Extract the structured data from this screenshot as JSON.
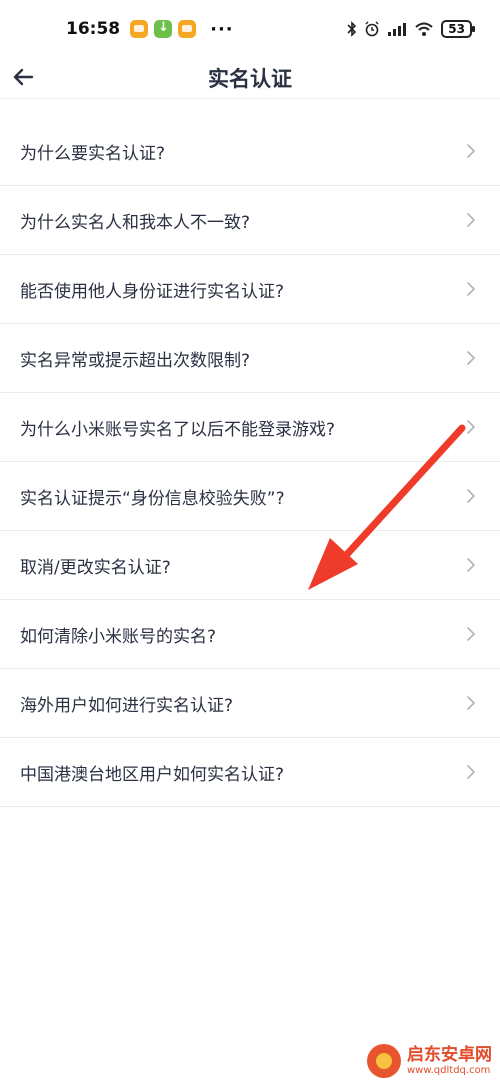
{
  "status_bar": {
    "time": "16:58",
    "battery": "53",
    "icons": [
      "notification-orange-icon",
      "download-green-icon",
      "notification-orange-icon",
      "more-dots-icon",
      "bluetooth-icon",
      "alarm-icon",
      "signal-icon",
      "wifi-icon",
      "battery-icon"
    ],
    "more": "···"
  },
  "header": {
    "title": "实名认证",
    "back_icon": "arrow-left-icon"
  },
  "faq_items": [
    {
      "label": "为什么要实名认证?"
    },
    {
      "label": "为什么实名人和我本人不一致?"
    },
    {
      "label": "能否使用他人身份证进行实名认证?"
    },
    {
      "label": "实名异常或提示超出次数限制?"
    },
    {
      "label": "为什么小米账号实名了以后不能登录游戏?"
    },
    {
      "label": "实名认证提示“身份信息校验失败”?"
    },
    {
      "label": "取消/更改实名认证?"
    },
    {
      "label": "如何清除小米账号的实名?"
    },
    {
      "label": "海外用户如何进行实名认证?"
    },
    {
      "label": "中国港澳台地区用户如何实名认证?"
    }
  ],
  "annotation": {
    "color": "#ee3b2a",
    "icon": "red-arrow-annotation"
  },
  "watermark": {
    "name": "启东安卓网",
    "url": "www.qdltdq.com"
  },
  "colors": {
    "text": "#2b3142",
    "divider": "#ececec",
    "chevron": "#b0b4bb"
  }
}
